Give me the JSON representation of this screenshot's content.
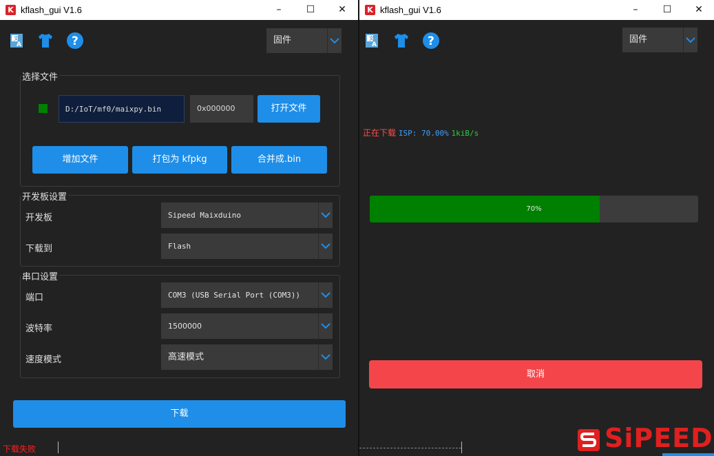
{
  "window": {
    "title": "kflash_gui V1.6"
  },
  "toolbar": {
    "mode": "固件"
  },
  "file_group": {
    "title": "选择文件",
    "path": "D:/IoT/mf0/maixpy.bin",
    "address": "0x000000",
    "open_button": "打开文件",
    "add_file_button": "增加文件",
    "pack_button": "打包为 kfpkg",
    "merge_button": "合并成.bin"
  },
  "board_group": {
    "title": "开发板设置",
    "board_label": "开发板",
    "board_value": "Sipeed Maixduino",
    "target_label": "下载到",
    "target_value": "Flash"
  },
  "serial_group": {
    "title": "串口设置",
    "port_label": "端口",
    "port_value": "COM3 (USB Serial Port (COM3))",
    "baud_label": "波特率",
    "baud_value": "1500000",
    "speed_label": "速度模式",
    "speed_value": "高速模式"
  },
  "download_button": "下载",
  "status_text": "下载失败",
  "progress": {
    "status_prefix": "正在下载",
    "isp_text": "ISP: 70.00%",
    "rate_text": "1kiB/s",
    "percent": 70,
    "percent_label": "70%"
  },
  "cancel_button": "取消",
  "watermark": "SiPEED",
  "colors": {
    "accent": "#1e8ee8",
    "progress": "#008000",
    "cancel": "#f4464a",
    "error": "#ff2020"
  }
}
